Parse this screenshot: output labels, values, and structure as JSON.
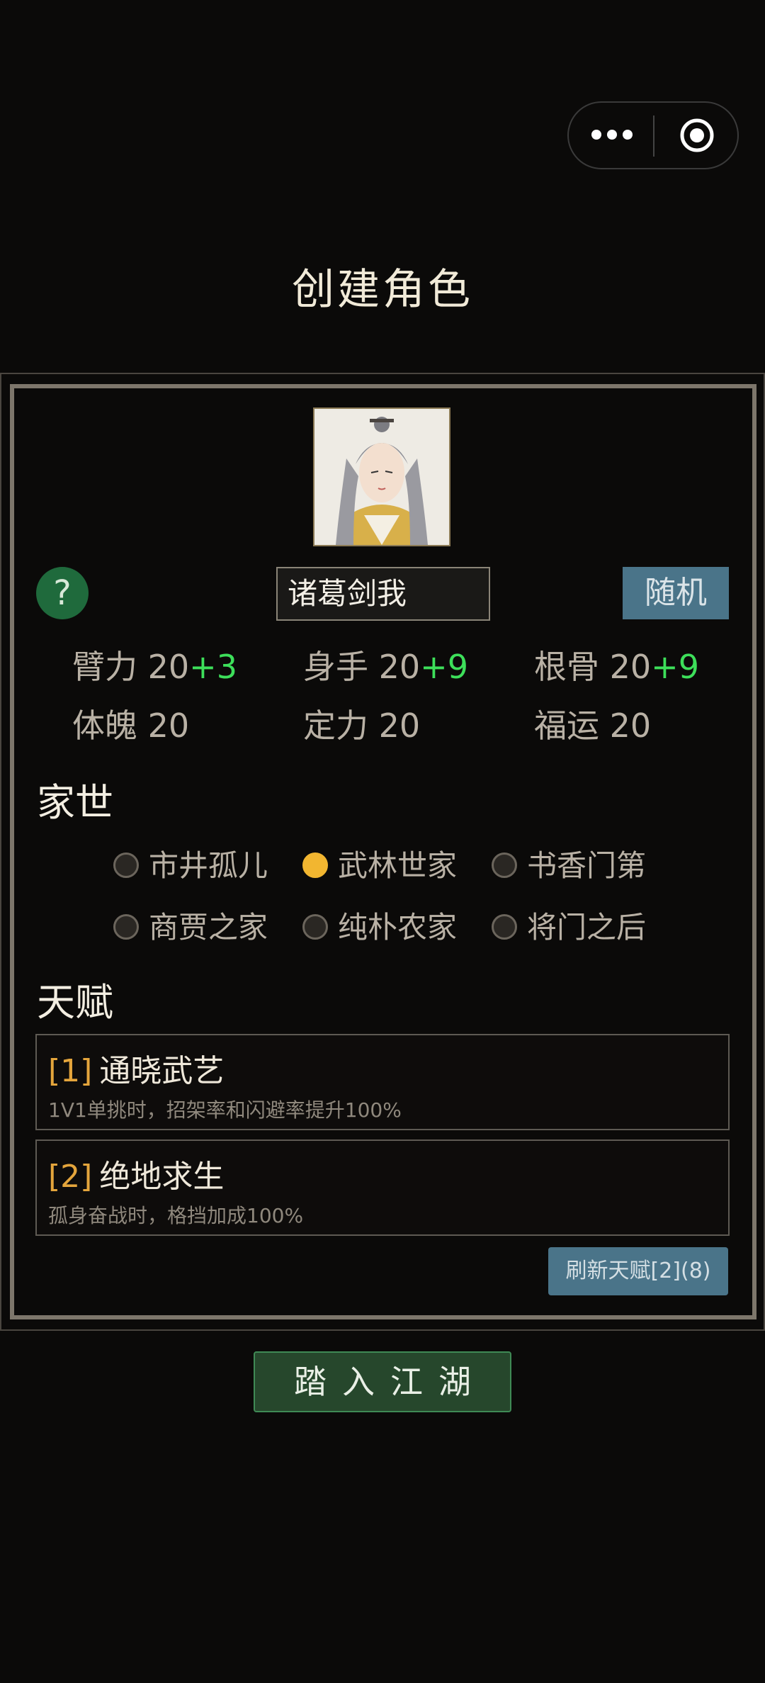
{
  "page_title": "创建角色",
  "character": {
    "name": "诸葛剑我",
    "random_label": "随机",
    "help_label": "?"
  },
  "stats": [
    {
      "label": "臂力",
      "base": "20",
      "bonus": "+3"
    },
    {
      "label": "身手",
      "base": "20",
      "bonus": "+9"
    },
    {
      "label": "根骨",
      "base": "20",
      "bonus": "+9"
    },
    {
      "label": "体魄",
      "base": "20",
      "bonus": ""
    },
    {
      "label": "定力",
      "base": "20",
      "bonus": ""
    },
    {
      "label": "福运",
      "base": "20",
      "bonus": ""
    }
  ],
  "family": {
    "title": "家世",
    "selected": "武林世家",
    "options": [
      "市井孤儿",
      "武林世家",
      "书香门第",
      "商贾之家",
      "纯朴农家",
      "将门之后"
    ]
  },
  "talents": {
    "title": "天赋",
    "items": [
      {
        "index": "[1]",
        "name": "通晓武艺",
        "desc": "1V1单挑时，招架率和闪避率提升100%"
      },
      {
        "index": "[2]",
        "name": "绝地求生",
        "desc": "孤身奋战时，格挡加成100%"
      }
    ],
    "refresh_label": "刷新天赋[2](8)"
  },
  "enter_label": "踏入江湖",
  "colors": {
    "background": "#0b0a09",
    "stat_bonus": "#3ddf5a",
    "selected_radio": "#f2b630",
    "random_button": "#4a7489",
    "help_button": "#1f6a3c",
    "enter_button": "#26472c"
  },
  "icons": [
    "more-dots-icon",
    "target-close-icon",
    "question-icon"
  ]
}
